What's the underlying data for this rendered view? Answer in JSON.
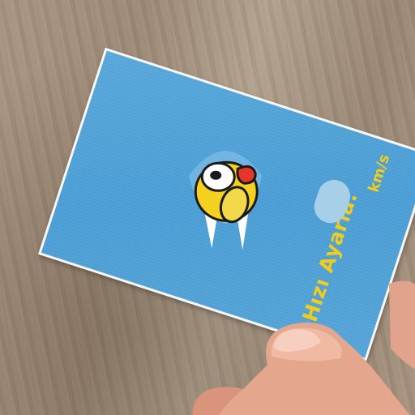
{
  "card": {
    "speed_label": "Hızı Ayarla:",
    "speed_unit": "km/s",
    "speed_value": ""
  },
  "icons": {
    "mascot": "bird-mascot-icon"
  },
  "colors": {
    "card_blue": "#4c9fd6",
    "label_yellow": "#f2cc1d",
    "input_light_blue": "#a8cfe8",
    "bird_yellow": "#f5d11f",
    "beak_red": "#e8352b"
  }
}
